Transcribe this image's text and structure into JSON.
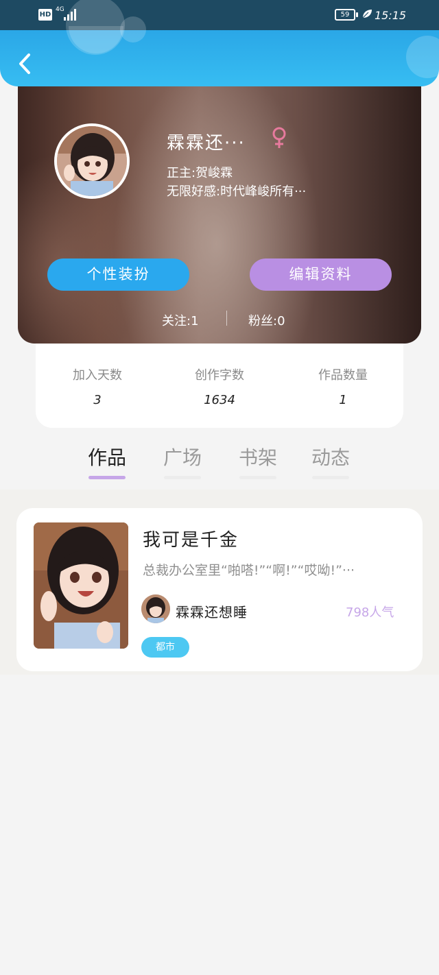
{
  "status_bar": {
    "hd": "HD",
    "network": "4G",
    "battery": "59",
    "time": "15:15"
  },
  "header": {
    "back_icon": "chevron-left-icon"
  },
  "profile": {
    "nickname": "霖霖还···",
    "gender_icon": "female-icon",
    "bio_line1": "正主:贺峻霖",
    "bio_line2": "无限好感:时代峰峻所有···",
    "btn_dress": "个性装扮",
    "btn_edit": "编辑资料",
    "follow": "关注:1",
    "fans": "粉丝:0"
  },
  "stats": [
    {
      "label": "加入天数",
      "value": "3"
    },
    {
      "label": "创作字数",
      "value": "1634"
    },
    {
      "label": "作品数量",
      "value": "1"
    }
  ],
  "tabs": [
    {
      "label": "作品",
      "active": true
    },
    {
      "label": "广场",
      "active": false
    },
    {
      "label": "书架",
      "active": false
    },
    {
      "label": "动态",
      "active": false
    }
  ],
  "works": [
    {
      "title": "我可是千金",
      "description": "总裁办公室里“啪嗒!”“啊!”“哎呦!”···",
      "author": "霖霖还想睡",
      "popularity": "798人气",
      "tag": "都市"
    }
  ],
  "colors": {
    "accent_blue": "#2aa8ee",
    "accent_purple": "#b98fe3",
    "tab_active_underline": "#c6a6e8",
    "tag_blue": "#4dc8f2"
  }
}
